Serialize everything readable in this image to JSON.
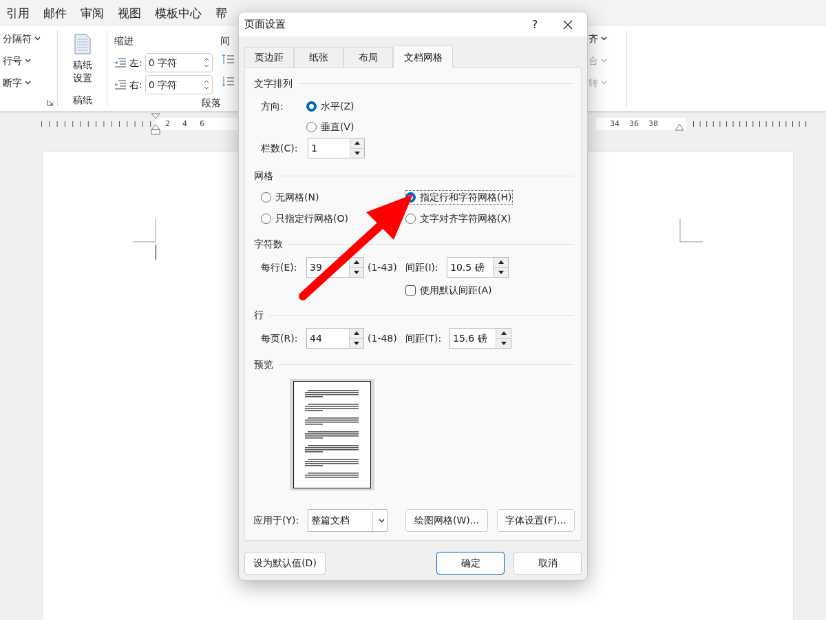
{
  "menu_bar": [
    {
      "label": "引用"
    },
    {
      "label": "邮件"
    },
    {
      "label": "审阅"
    },
    {
      "label": "视图"
    },
    {
      "label": "模板中心"
    },
    {
      "label": "帮"
    }
  ],
  "ribbon": {
    "page_items": [
      {
        "label": "分隔符"
      },
      {
        "label": "行号"
      },
      {
        "label": "断字"
      }
    ],
    "manuscript": {
      "button": "稿纸设置",
      "group_label": "稿纸"
    },
    "indent": {
      "title": "缩进",
      "fields": [
        {
          "kind": "left",
          "label": "左:",
          "value": "0 字符"
        },
        {
          "kind": "right",
          "label": "右:",
          "value": "0 字符"
        }
      ]
    },
    "spacing_title": "间",
    "paragraph_label": "段落",
    "arrange_items": [
      {
        "label": "齐",
        "disabled": false
      },
      {
        "label": "合",
        "disabled": true
      },
      {
        "label": "转",
        "disabled": true
      }
    ]
  },
  "ruler": {
    "left_labels": [
      "2",
      "4",
      "6"
    ],
    "right_labels": [
      "34",
      "36",
      "38"
    ]
  },
  "dialog": {
    "title": "页面设置",
    "help": "?",
    "tabs": [
      {
        "label": "页边距",
        "selected": false
      },
      {
        "label": "纸张",
        "selected": false
      },
      {
        "label": "布局",
        "selected": false
      },
      {
        "label": "文档网格",
        "selected": true
      }
    ],
    "text_flow": {
      "title": "文字排列",
      "direction_label": "方向:",
      "directions": [
        {
          "label": "水平(Z)",
          "selected": true
        },
        {
          "label": "垂直(V)",
          "selected": false
        }
      ],
      "columns_label": "栏数(C):",
      "columns_value": "1"
    },
    "grid": {
      "title": "网格",
      "options": [
        {
          "label": "无网格(N)",
          "selected": false
        },
        {
          "label": "指定行和字符网格(H)",
          "selected": true
        },
        {
          "label": "只指定行网格(O)",
          "selected": false
        },
        {
          "label": "文字对齐字符网格(X)",
          "selected": false
        }
      ]
    },
    "characters": {
      "title": "字符数",
      "per_line_label": "每行(E):",
      "per_line_value": "39",
      "range": "(1-43)",
      "pitch_label": "间距(I):",
      "pitch_value": "10.5 磅",
      "default_pitch": {
        "label": "使用默认间距(A)",
        "checked": false
      }
    },
    "lines": {
      "title": "行",
      "per_page_label": "每页(R):",
      "per_page_value": "44",
      "range": "(1-48)",
      "pitch_label": "间距(T):",
      "pitch_value": "15.6 磅"
    },
    "preview": {
      "title": "预览"
    },
    "apply_to": {
      "label": "应用于(Y):",
      "value": "整篇文档"
    },
    "panel_buttons": [
      "绘图网格(W)...",
      "字体设置(F)..."
    ],
    "footer": {
      "set_default": "设为默认值(D)",
      "ok": "确定",
      "cancel": "取消"
    }
  }
}
